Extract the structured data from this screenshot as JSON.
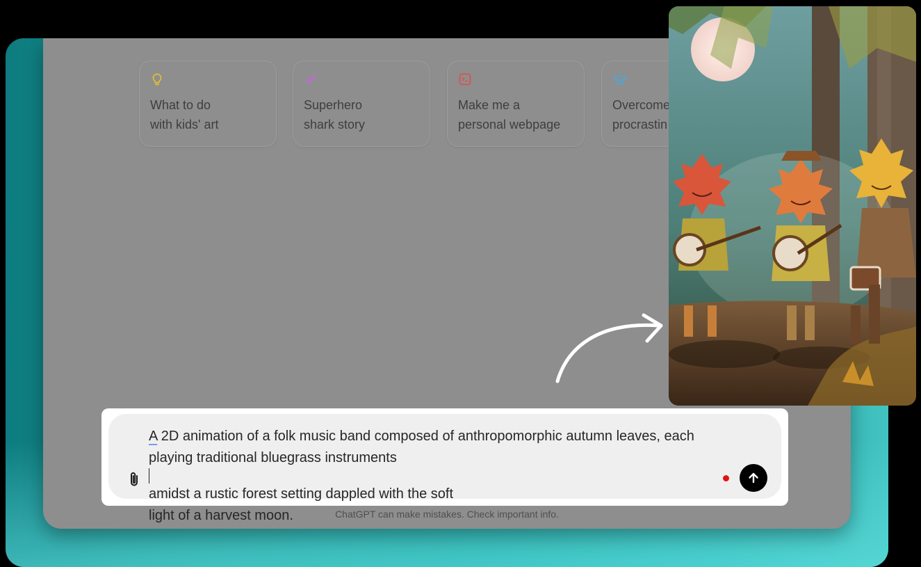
{
  "suggestions": [
    {
      "line1": "What to do",
      "line2": "with kids' art",
      "icon": "lightbulb-icon",
      "icon_color": "#e4c12c"
    },
    {
      "line1": "Superhero",
      "line2": "shark story",
      "icon": "pen-icon",
      "icon_color": "#b96fcf"
    },
    {
      "line1": "Make me a",
      "line2": "personal webpage",
      "icon": "terminal-icon",
      "icon_color": "#d9534f"
    },
    {
      "line1": "Overcome",
      "line2": "procrastin",
      "icon": "graduation-cap-icon",
      "icon_color": "#4ea6d6"
    }
  ],
  "composer": {
    "word_first": "A",
    "line1_rest": " 2D animation of a folk music band composed of anthropomorphic autumn leaves, each",
    "line2_before_caret": "playing traditional bluegrass instruments",
    "line2_after_caret": "amidst a rustic forest setting dappled with the soft",
    "line3": "light of a harvest moon."
  },
  "footer": {
    "disclaimer": "ChatGPT can make mistakes. Check important info."
  },
  "colors": {
    "backdrop": "#1aa3a0",
    "window": "#8e8e8e",
    "send_button": "#000000",
    "record_dot": "#e31313"
  }
}
